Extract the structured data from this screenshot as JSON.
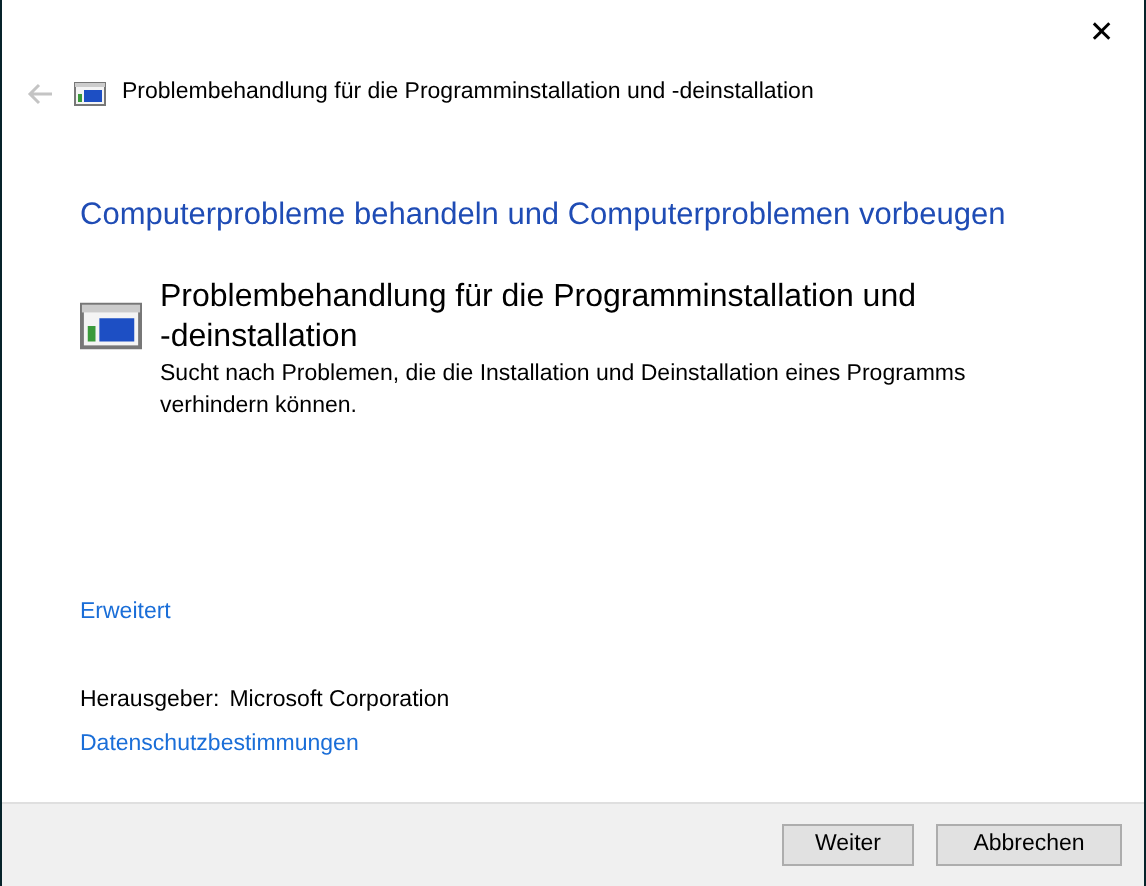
{
  "window": {
    "close_glyph": "✕"
  },
  "header": {
    "back_disabled": true,
    "title": "Problembehandlung für die Programminstallation und -deinstallation"
  },
  "heading": "Computerprobleme behandeln und Computerproblemen vorbeugen",
  "troubleshooter": {
    "title_lines": [
      "Problembehandlung für die Programminstallation und",
      "-deinstallation"
    ],
    "description": "Sucht nach Problemen, die die Installation und Deinstallation eines Programms verhindern können."
  },
  "advanced_link": "Erweitert",
  "publisher": {
    "label": "Herausgeber:",
    "value": "Microsoft Corporation"
  },
  "privacy_link": "Datenschutzbestimmungen",
  "buttons": [
    "Weiter",
    "Abbrechen"
  ]
}
